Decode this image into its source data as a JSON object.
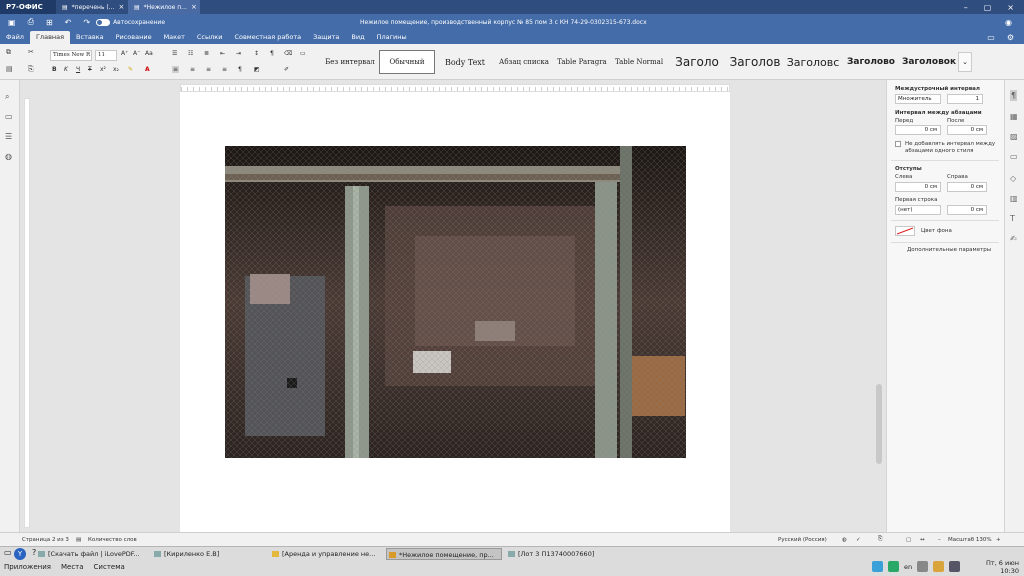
{
  "app": {
    "name": "Р7-ОФИС",
    "tabs": [
      {
        "label": "*перечень (...",
        "active": false
      },
      {
        "label": "*Нежилое п...",
        "active": true
      }
    ],
    "document_title": "Нежилое помещение, производственный корпус № 85 пом 3 с КН 74-29-0302315-673.docx",
    "autosave_label": "Автосохранение"
  },
  "menu": [
    "Файл",
    "Главная",
    "Вставка",
    "Рисование",
    "Макет",
    "Ссылки",
    "Совместная работа",
    "Защита",
    "Вид",
    "Плагины"
  ],
  "menu_active": "Главная",
  "toolbar": {
    "font_name": "Times New R",
    "font_size": "11",
    "styles": [
      "Без интервал",
      "Обычный",
      "Body Text",
      "Абзац списка",
      "Table Paragra",
      "Table Normal",
      "Заголо",
      "Заголов",
      "Заголовс",
      "Заголово",
      "Заголовок"
    ],
    "selected_style": "Обычный"
  },
  "right_panel": {
    "line_spacing_title": "Междустрочный интервал",
    "line_spacing_mode": "Множитель",
    "line_spacing_value": "1",
    "para_spacing_title": "Интервал между абзацами",
    "before_label": "Перед",
    "after_label": "После",
    "before_value": "0 см",
    "after_value": "0 см",
    "no_interval_label_1": "Не добавлять интервал между",
    "no_interval_label_2": "абзацами одного стиля",
    "indents_title": "Отступы",
    "left_label": "Слева",
    "right_label": "Справа",
    "left_value": "0 см",
    "right_value": "0 см",
    "first_line_label": "Первая строка",
    "first_line_mode": "(нет)",
    "first_line_value": "0 см",
    "background_label": "Цвет фона",
    "advanced_label": "Дополнительные параметры"
  },
  "status": {
    "page": "Страница 2 из 3",
    "word_count": "Количество слов",
    "language": "Русский (Россия)",
    "zoom": "Масштаб 130%"
  },
  "taskbar": {
    "tasks": [
      {
        "label": "[Скачать файл | iLovePDF...",
        "active": false
      },
      {
        "label": "[Кириленко Е.В]",
        "active": false
      },
      {
        "label": "[Аренда и управление не...",
        "active": false
      },
      {
        "label": "*Нежилое помещение, пр...",
        "active": true
      },
      {
        "label": "[Лот 3 П13740007660]",
        "active": false
      }
    ],
    "system_menu": [
      "Приложения",
      "Места",
      "Система"
    ],
    "keyboard_layout": "en",
    "date": "Пт, 6 июн",
    "time": "10:30"
  },
  "colors": {
    "titlebar": "#2f4d7f",
    "ribbon": "#446ca9",
    "toolbar_bg": "#f1f1f1"
  }
}
